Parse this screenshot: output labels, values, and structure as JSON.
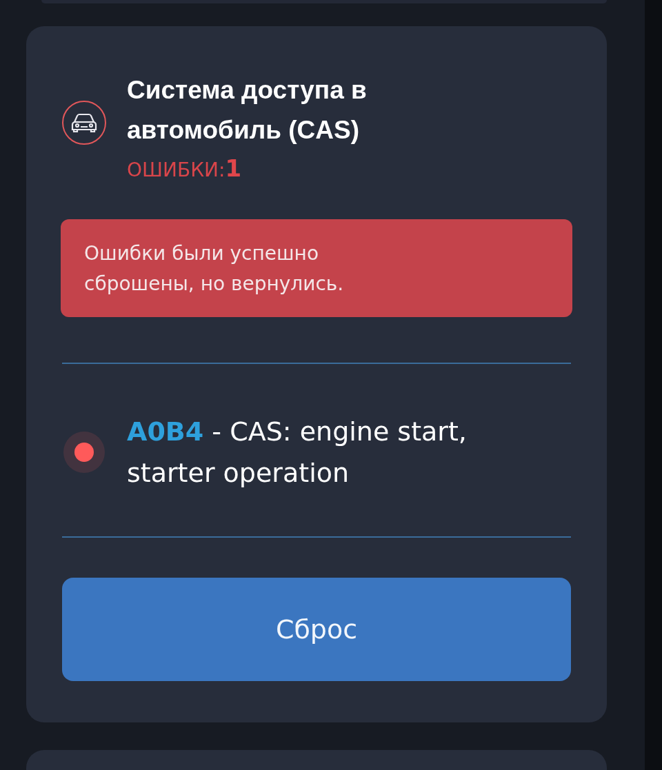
{
  "module": {
    "title": "Система доступа в автомобиль (CAS)",
    "errors_label": "ОШИБКИ:",
    "errors_count": "1",
    "alert": "Ошибки были успешно сброшены, но вернулись.",
    "faults": [
      {
        "code": "A0B4",
        "description": "- CAS: engine start, starter operation",
        "color": "#ff5a5a"
      }
    ],
    "reset_button": "Сброс"
  }
}
